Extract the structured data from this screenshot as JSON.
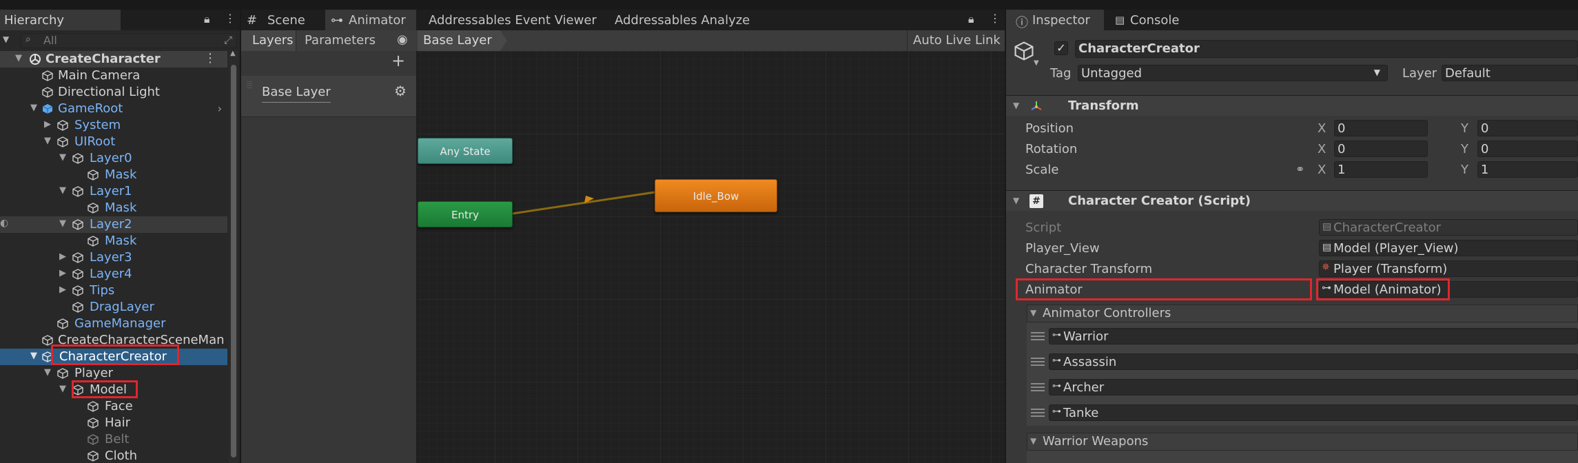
{
  "hierarchy": {
    "tab_label": "Hierarchy",
    "search_placeholder": "All",
    "scene_name": "CreateCharacter",
    "items": [
      {
        "label": "Main Camera"
      },
      {
        "label": "Directional Light"
      },
      {
        "label": "GameRoot"
      },
      {
        "label": "System"
      },
      {
        "label": "UIRoot"
      },
      {
        "label": "Layer0"
      },
      {
        "label": "Mask"
      },
      {
        "label": "Layer1"
      },
      {
        "label": "Mask"
      },
      {
        "label": "Layer2"
      },
      {
        "label": "Mask"
      },
      {
        "label": "Layer3"
      },
      {
        "label": "Layer4"
      },
      {
        "label": "Tips"
      },
      {
        "label": "DragLayer"
      },
      {
        "label": "GameManager"
      },
      {
        "label": "CreateCharacterSceneMan"
      },
      {
        "label": "CharacterCreator"
      },
      {
        "label": "Player"
      },
      {
        "label": "Model"
      },
      {
        "label": "Face"
      },
      {
        "label": "Hair"
      },
      {
        "label": "Belt"
      },
      {
        "label": "Cloth"
      }
    ]
  },
  "animator": {
    "tabs": [
      "Scene",
      "Animator",
      "Addressables Event Viewer",
      "Addressables Analyze"
    ],
    "toolbar": {
      "layers_label": "Layers",
      "parameters_label": "Parameters",
      "breadcrumb": "Base Layer",
      "auto_live_link": "Auto Live Link"
    },
    "layer_name": "Base Layer",
    "states": {
      "any_state": "Any State",
      "entry": "Entry",
      "idle": "Idle_Bow"
    }
  },
  "inspector": {
    "tabs": [
      "Inspector",
      "Console"
    ],
    "object_name": "CharacterCreator",
    "tag_label": "Tag",
    "tag_value": "Untagged",
    "layer_label": "Layer",
    "layer_value": "Default",
    "transform": {
      "title": "Transform",
      "rows": [
        {
          "label": "Position",
          "x": "0",
          "y": "0"
        },
        {
          "label": "Rotation",
          "x": "0",
          "y": "0"
        },
        {
          "label": "Scale",
          "x": "1",
          "y": "1"
        }
      ],
      "x_axis": "X",
      "y_axis": "Y"
    },
    "script_component": {
      "title": "Character Creator (Script)",
      "fields": [
        {
          "label": "Script",
          "value": "CharacterCreator"
        },
        {
          "label": "Player_View",
          "value": "Model (Player_View)"
        },
        {
          "label": "Character Transform",
          "value": "Player (Transform)"
        },
        {
          "label": "Animator",
          "value": "Model (Animator)"
        }
      ],
      "controllers_label": "Animator Controllers",
      "controllers": [
        "Warrior",
        "Assassin",
        "Archer",
        "Tanke"
      ],
      "weapons_label": "Warrior Weapons"
    }
  },
  "colors": {
    "selection": "#2c5d87",
    "highlight_red": "#e0262d",
    "prefab_blue": "#7cb4f7",
    "any_state": "#4e9b8f",
    "entry": "#1f8a3a",
    "idle_state": "#e07a17"
  }
}
